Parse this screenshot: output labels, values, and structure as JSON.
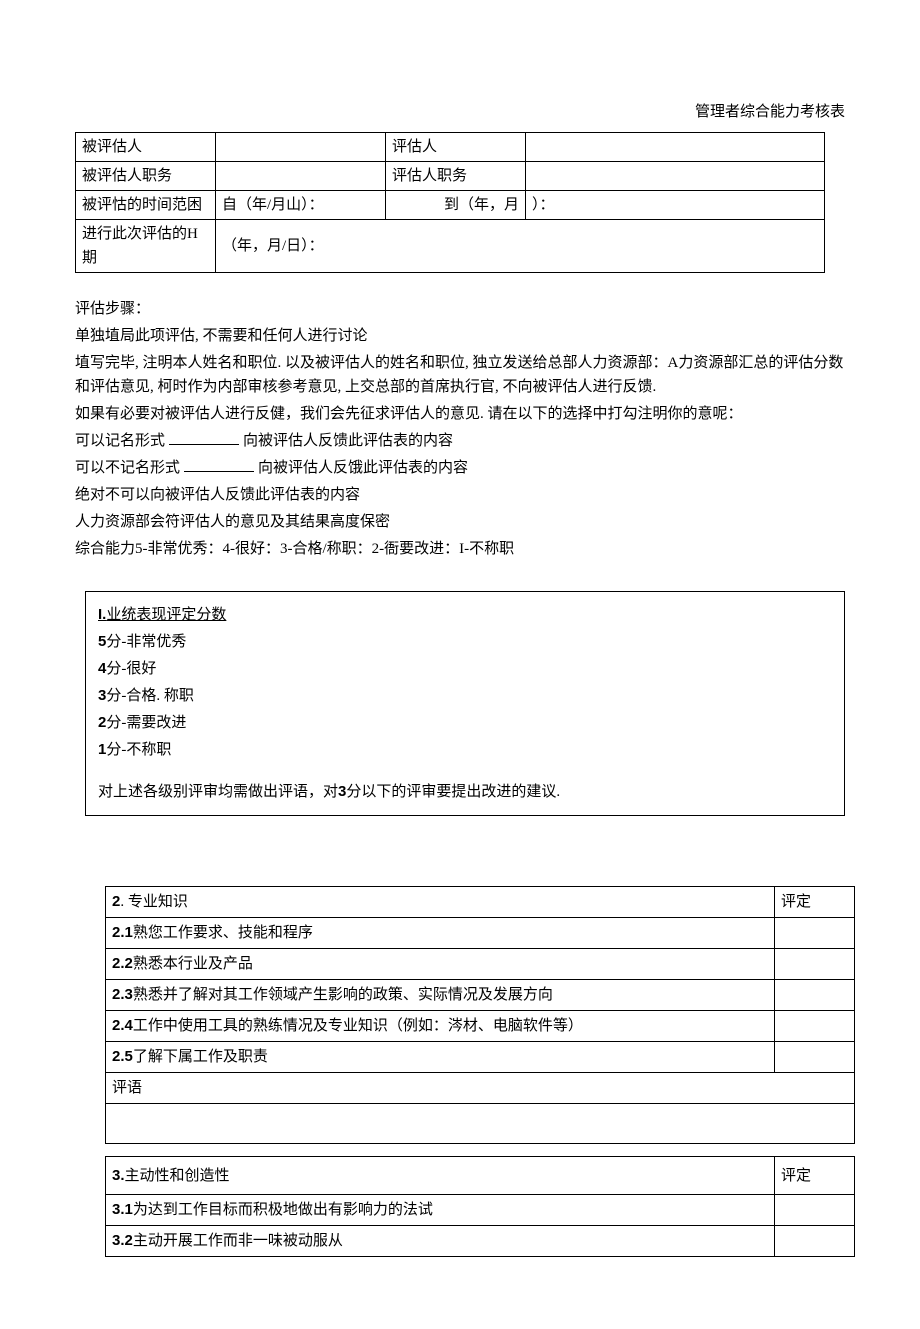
{
  "title": "管理者综合能力考核表",
  "info": {
    "r1c1": "被评估人",
    "r1c3": "评估人",
    "r2c1": "被评估人职务",
    "r2c3": "评估人职务",
    "r3c1": "被评怙的时间范困",
    "r3c2": "自（年/月山）：",
    "r3c3": "到（年，月",
    "r3c4": "）：",
    "r4c1": "进行此次评估的H期",
    "r4c2": "（年，月/日）："
  },
  "steps_title": "评估步骤：",
  "steps": [
    "单独埴局此项评估, 不需要和任何人进行讨论",
    "埴写完毕, 注明本人姓名和职位. 以及被评估人的姓名和职位, 独立发送给总部人力资源部：A力资源部汇总的评估分数和评估意见, 柯时作为内部审核参考意见, 上交总部的首席执行官, 不向被评估人进行反馈.",
    "如果有必要对被评估人进行反健，我们会先征求评估人的意见. 请在以下的选择中打勾注明你的意呢：",
    "可以记名形式",
    "向被评估人反馈此评估表的内容",
    "可以不记名形式",
    "向被评估人反饿此评估表的内容",
    "绝对不可以向被评估人反馈此评估表的内容",
    "人力资源部会符评估人的意见及其结果高度保密",
    "综合能力5-非常优秀：4-很好：3-合格/称职：2-衙要改进：I-不称职"
  ],
  "section1": {
    "title_prefix": "I.",
    "title": "业统表现评定分数",
    "s5": "5",
    "s5t": "分-非常优秀",
    "s4": "4",
    "s4t": "分-很好",
    "s3": "3",
    "s3t": "分-合格. 称职",
    "s2": "2",
    "s2t": "分-需要改进",
    "s1": "1",
    "s1t": "分-不称职",
    "note_a": "对上述各级别评审均需做出评语，对",
    "note_b": "3",
    "note_c": "分以下的评审要提出改进的建议."
  },
  "t2": {
    "h_no": "2",
    "h_title": ". 专业知识",
    "h_rating": "评定",
    "r1_no": "2.1",
    "r1": "熟您工作要求、技能和程序",
    "r2_no": "2.2",
    "r2": "熟悉本行业及产品",
    "r3_no": "2.3",
    "r3": "熟悉并了解对其工作领域产生影响的政策、实际情况及发展方向",
    "r4_no": "2.4",
    "r4": "工作中使用工具的熟练情况及专业知识（例如：涔材、电脑软件等）",
    "r5_no": "2.5",
    "r5": "了解下属工作及职责",
    "comment": "评语"
  },
  "t3": {
    "h_no": "3.",
    "h_title": "主动性和创造性",
    "h_rating": "评定",
    "r1_no": "3.1",
    "r1": "为达到工作目标而积极地做出有影响力的法试",
    "r2_no": "3.2",
    "r2": "主动开展工作而非一味被动服从"
  }
}
